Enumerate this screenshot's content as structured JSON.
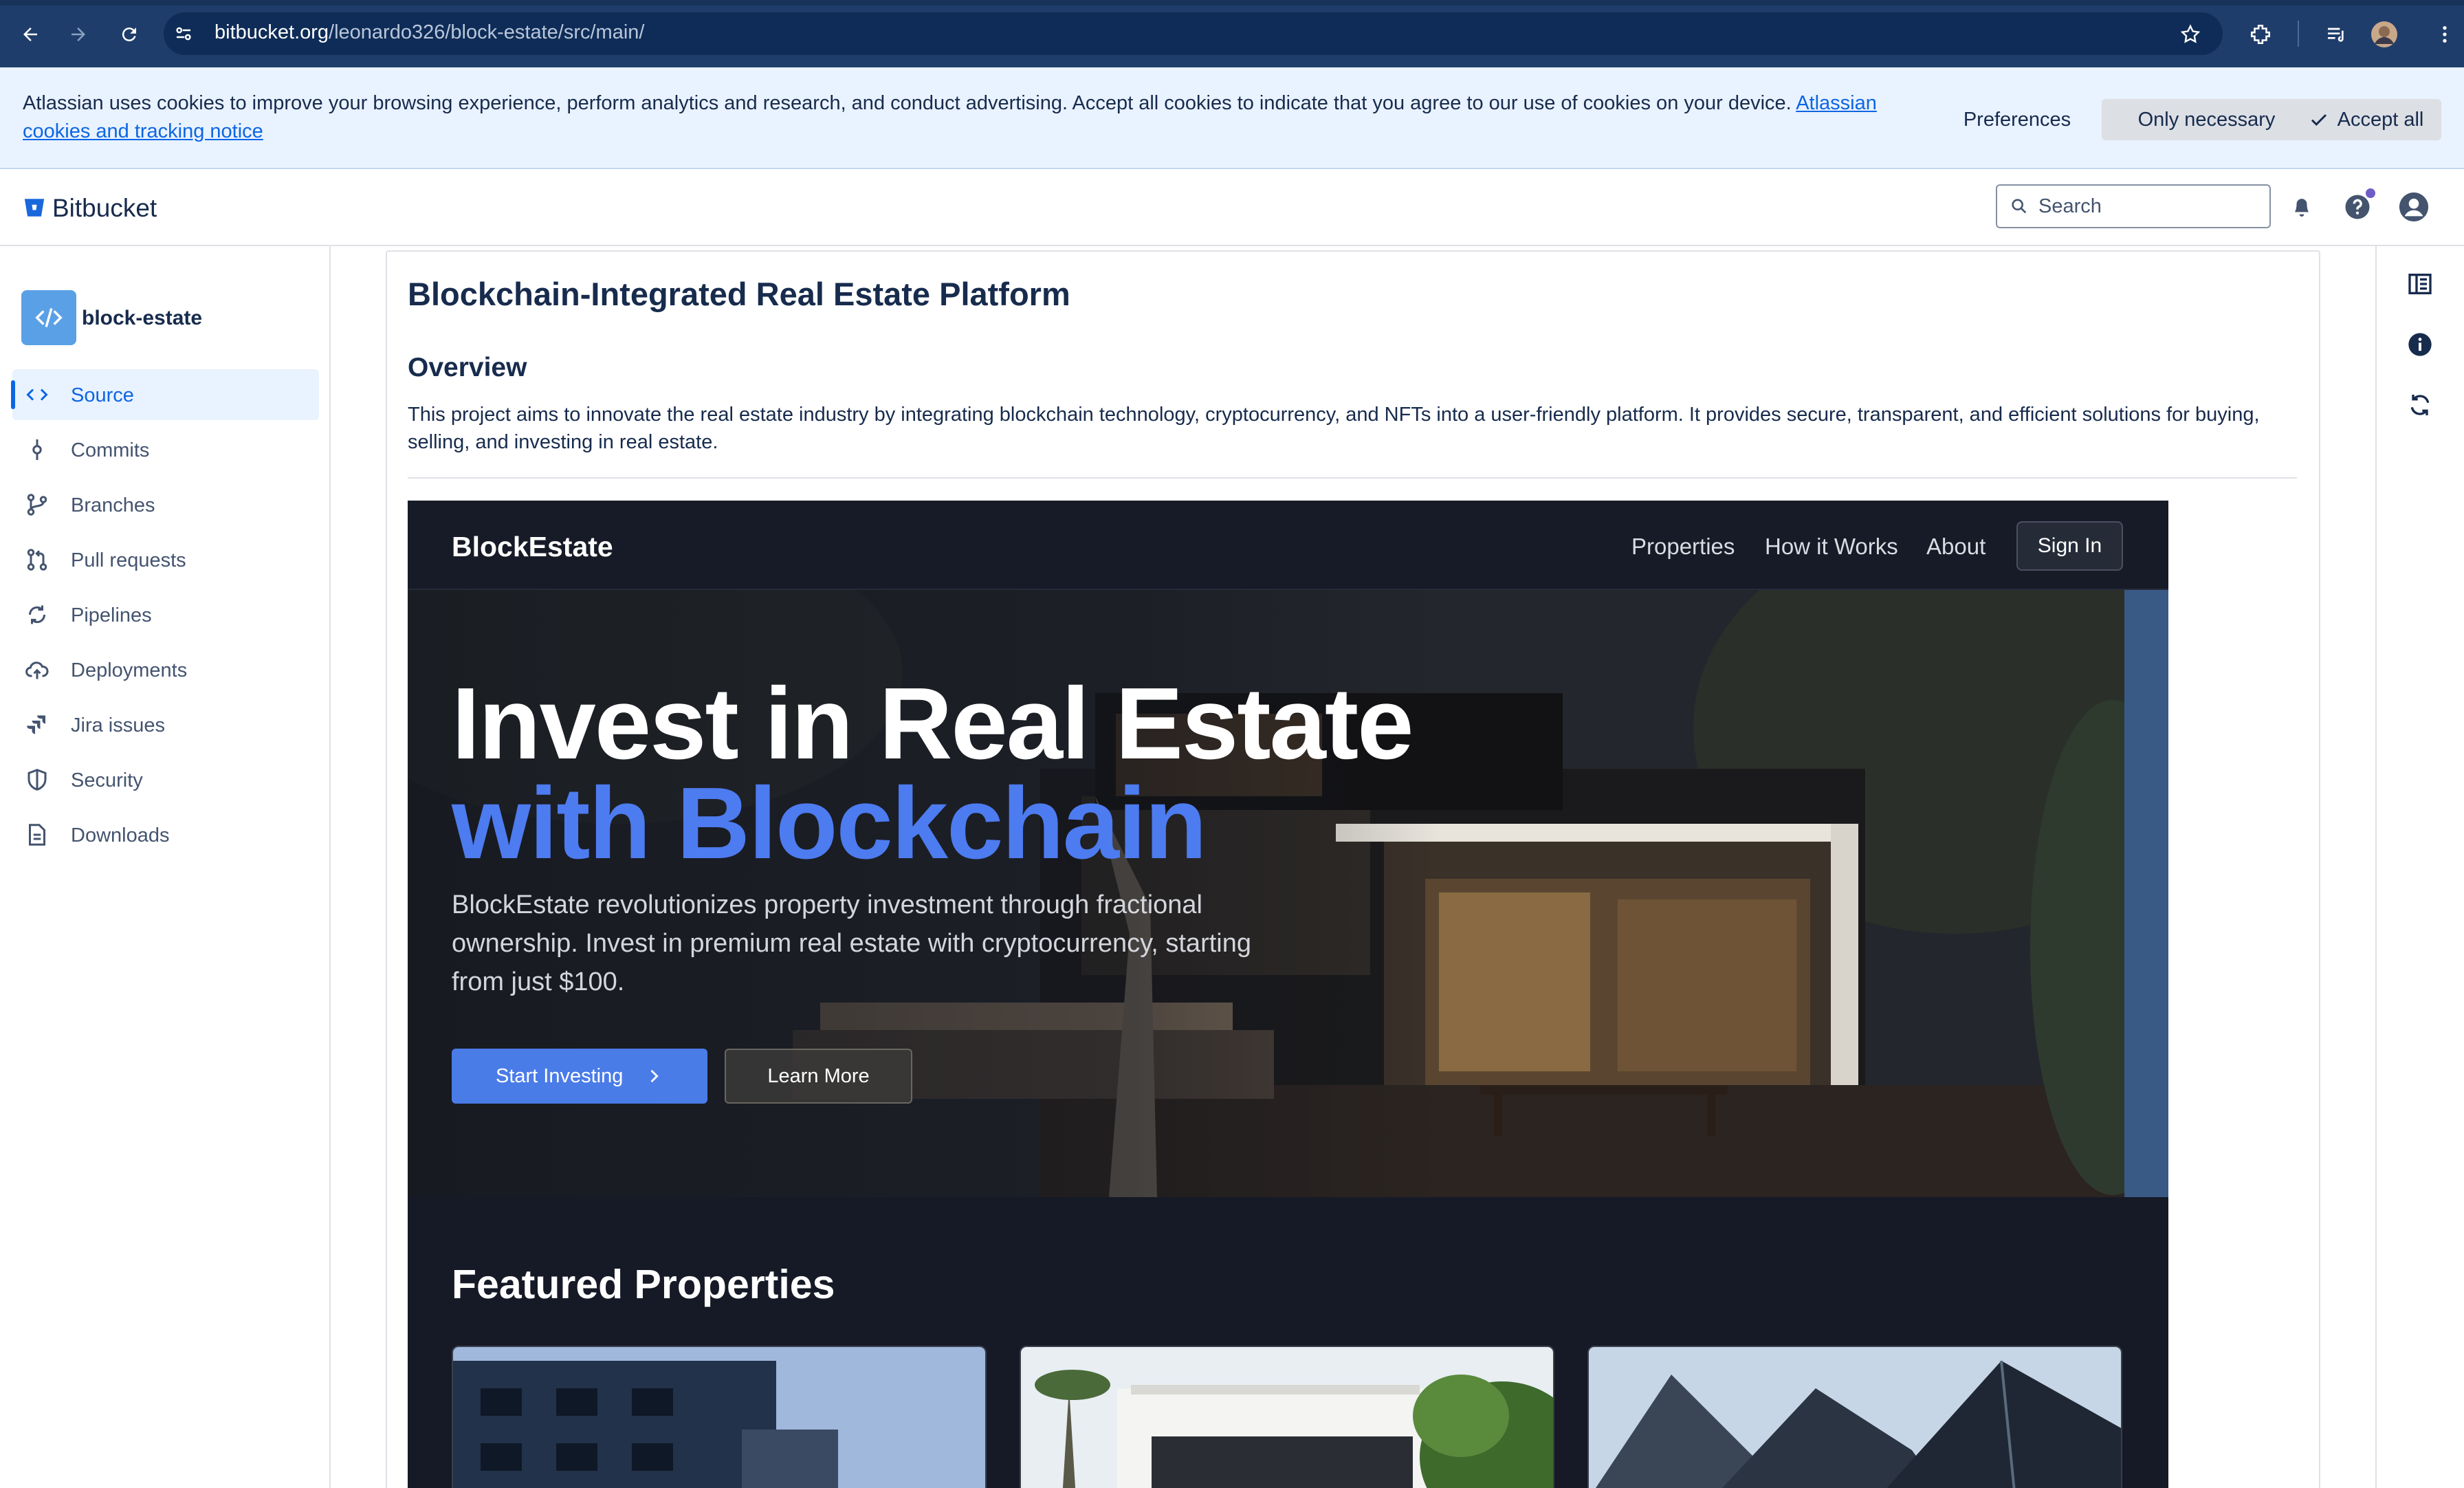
{
  "browser": {
    "url_host": "bitbucket.org",
    "url_path": "/leonardo326/block-estate/src/main/"
  },
  "cookie_banner": {
    "text": "Atlassian uses cookies to improve your browsing experience, perform analytics and research, and conduct advertising. Accept all cookies to indicate that you agree to our use of cookies on your device.",
    "link_text": "Atlassian cookies and tracking notice",
    "preferences_label": "Preferences",
    "only_necessary_label": "Only necessary",
    "accept_all_label": "Accept all"
  },
  "header": {
    "logo_text": "Bitbucket",
    "search_placeholder": "Search"
  },
  "sidebar": {
    "repo_name": "block-estate",
    "items": [
      {
        "label": "Source",
        "icon": "code-icon",
        "active": true
      },
      {
        "label": "Commits",
        "icon": "commit-icon"
      },
      {
        "label": "Branches",
        "icon": "branch-icon"
      },
      {
        "label": "Pull requests",
        "icon": "pull-request-icon"
      },
      {
        "label": "Pipelines",
        "icon": "pipelines-icon"
      },
      {
        "label": "Deployments",
        "icon": "cloud-upload-icon"
      },
      {
        "label": "Jira issues",
        "icon": "jira-icon"
      },
      {
        "label": "Security",
        "icon": "shield-icon"
      },
      {
        "label": "Downloads",
        "icon": "document-icon"
      }
    ]
  },
  "readme": {
    "title": "Blockchain-Integrated Real Estate Platform",
    "overview_heading": "Overview",
    "overview_text": "This project aims to innovate the real estate industry by integrating blockchain technology, cryptocurrency, and NFTs into a user-friendly platform. It provides secure, transparent, and efficient solutions for buying, selling, and investing in real estate."
  },
  "preview": {
    "brand": "BlockEstate",
    "nav_links": [
      "Properties",
      "How it Works",
      "About"
    ],
    "sign_in": "Sign In",
    "headline_line1": "Invest in Real Estate",
    "headline_line2": "with Blockchain",
    "description": "BlockEstate revolutionizes property investment through fractional ownership. Invest in premium real estate with cryptocurrency, starting from just $100.",
    "start_investing": "Start Investing",
    "learn_more": "Learn More",
    "featured_heading": "Featured Properties"
  },
  "colors": {
    "accent": "#0c66e4",
    "browser_bar": "#1f3d6b",
    "cookie_bg": "#e9f2ff",
    "preview_bg": "#161a26",
    "preview_accent": "#4d7bf0"
  }
}
